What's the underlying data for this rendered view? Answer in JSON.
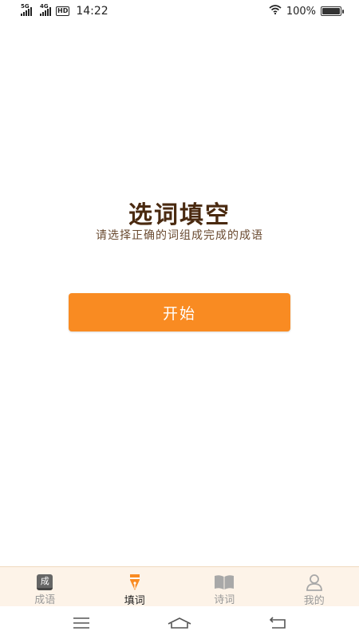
{
  "status_bar": {
    "network1": "5G",
    "network2": "4G",
    "hd": "HD",
    "time": "14:22",
    "battery": "100%"
  },
  "main": {
    "title": "选词填空",
    "subtitle": "请选择正确的词组成完成的成语",
    "start_button": "开始"
  },
  "tab_bar": {
    "active_index": 1,
    "accent_color": "#f98b22",
    "tabs": [
      {
        "label": "成语",
        "icon": "idiom-book-icon",
        "icon_text": "成"
      },
      {
        "label": "填词",
        "icon": "pen-nib-icon"
      },
      {
        "label": "诗词",
        "icon": "open-book-icon"
      },
      {
        "label": "我的",
        "icon": "user-icon"
      }
    ]
  },
  "nav_bar": {
    "buttons": [
      "menu-icon",
      "home-icon",
      "back-icon"
    ]
  }
}
